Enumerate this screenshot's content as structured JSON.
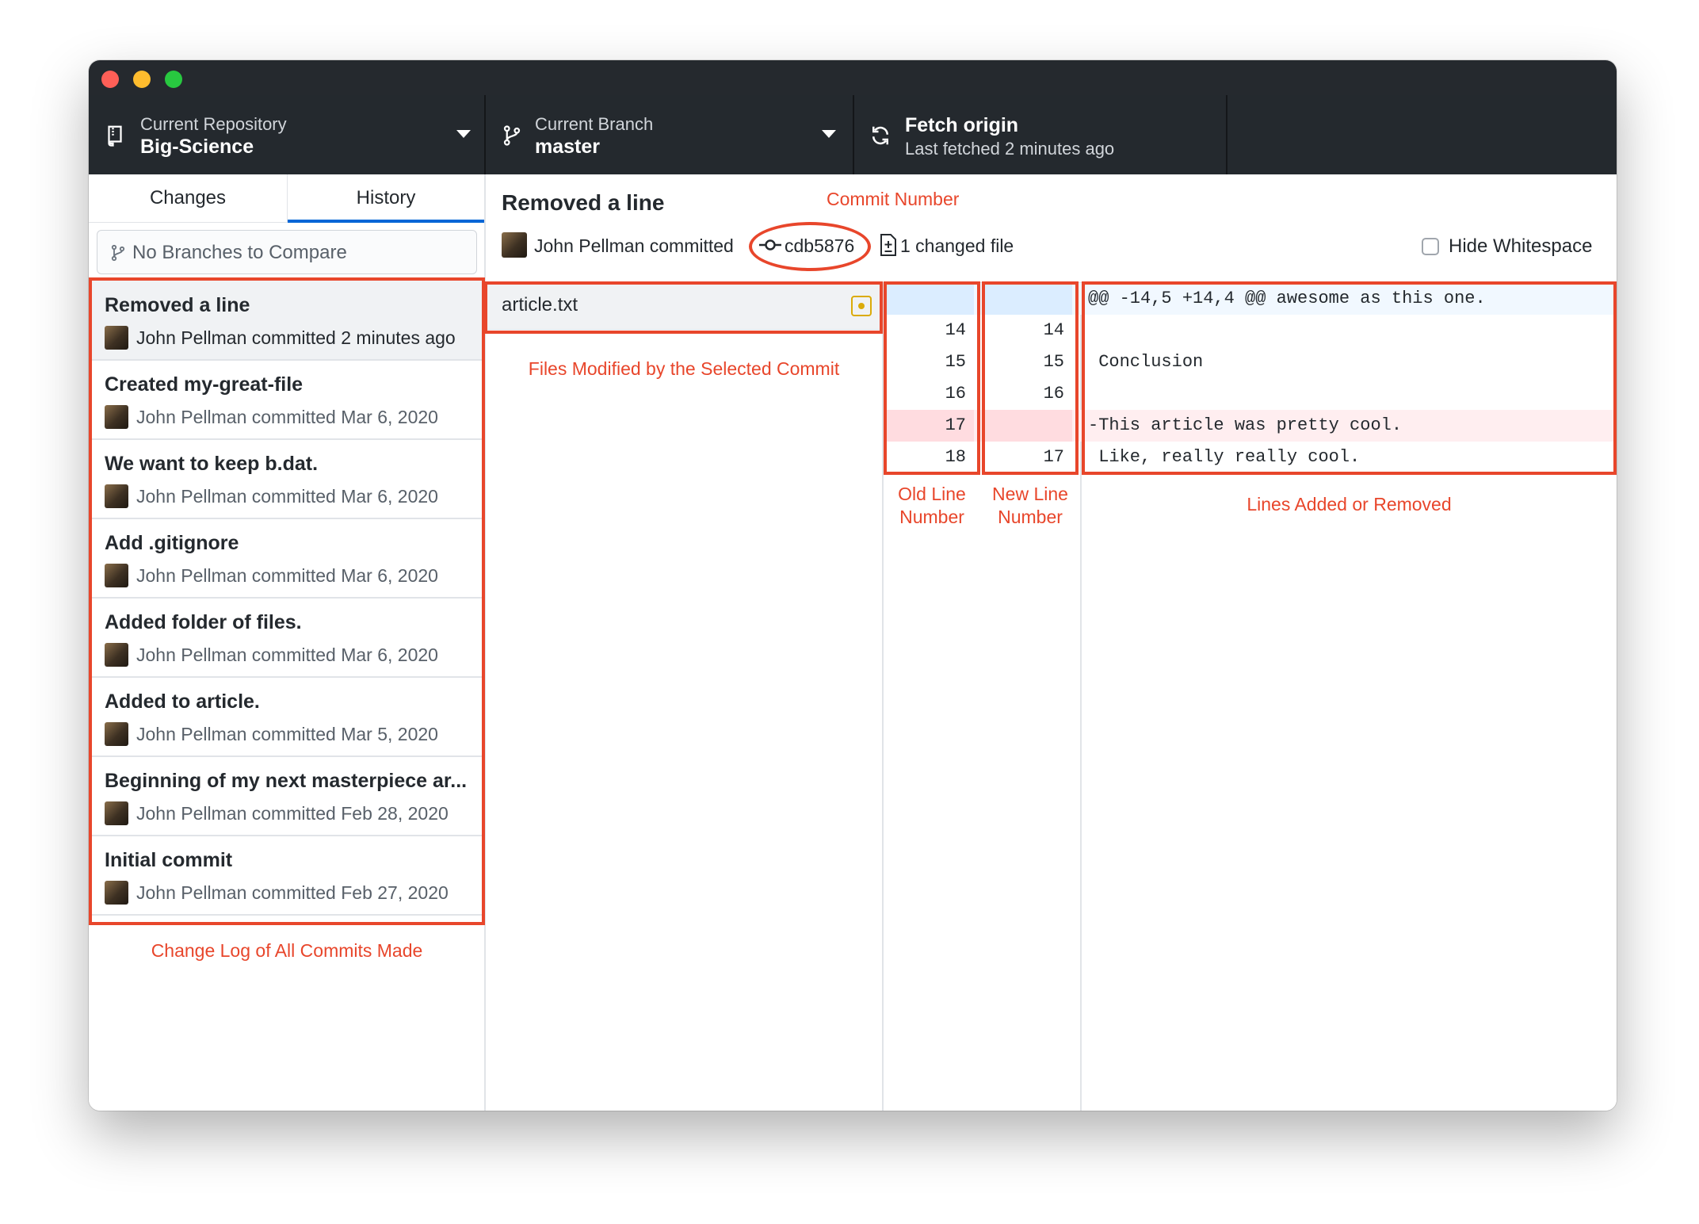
{
  "toolbar": {
    "repository": {
      "label": "Current Repository",
      "value": "Big-Science"
    },
    "branch": {
      "label": "Current Branch",
      "value": "master"
    },
    "fetch": {
      "label": "Fetch origin",
      "sub": "Last fetched 2 minutes ago"
    }
  },
  "sidebar": {
    "tabs": [
      "Changes",
      "History"
    ],
    "compare_placeholder": "No Branches to Compare",
    "commits": [
      {
        "title": "Removed a line",
        "meta": "John Pellman committed 2 minutes ago"
      },
      {
        "title": "Created my-great-file",
        "meta": "John Pellman committed Mar 6, 2020"
      },
      {
        "title": "We want to keep b.dat.",
        "meta": "John Pellman committed Mar 6, 2020"
      },
      {
        "title": "Add .gitignore",
        "meta": "John Pellman committed Mar 6, 2020"
      },
      {
        "title": "Added folder of files.",
        "meta": "John Pellman committed Mar 6, 2020"
      },
      {
        "title": "Added to article.",
        "meta": "John Pellman committed Mar 5, 2020"
      },
      {
        "title": "Beginning of my next masterpiece ar...",
        "meta": "John Pellman committed Feb 28, 2020"
      },
      {
        "title": "Initial commit",
        "meta": "John Pellman committed Feb 27, 2020"
      }
    ]
  },
  "commit": {
    "title": "Removed a line",
    "author_line": "John Pellman committed",
    "sha": "cdb5876",
    "changed_files": "1 changed file",
    "hide_whitespace_label": "Hide Whitespace"
  },
  "files": [
    {
      "name": "article.txt"
    }
  ],
  "diff": {
    "hunk_header": "@@ -14,5 +14,4 @@ awesome as this one.",
    "rows": [
      {
        "old": "14",
        "new": "14",
        "code": "",
        "type": "context"
      },
      {
        "old": "15",
        "new": "15",
        "code": " Conclusion",
        "type": "context"
      },
      {
        "old": "16",
        "new": "16",
        "code": "",
        "type": "context"
      },
      {
        "old": "17",
        "new": "",
        "code": "-This article was pretty cool.",
        "type": "deleted"
      },
      {
        "old": "18",
        "new": "17",
        "code": " Like, really really cool.",
        "type": "context"
      }
    ]
  },
  "annotations": {
    "commit_number": "Commit Number",
    "files_modified": "Files Modified by the Selected Commit",
    "old_line": [
      "Old Line",
      "Number"
    ],
    "new_line": [
      "New Line",
      "Number"
    ],
    "lines_changed": "Lines Added or Removed",
    "change_log": "Change Log of All Commits Made"
  },
  "colors": {
    "annotation": "#e8462b",
    "toolbar_bg": "#24292e",
    "tab_accent": "#0366d6",
    "deleted_line_bg": "#ffeef0",
    "hunk_bg": "#f1f8ff",
    "modified_status": "#dbab09"
  },
  "icons": [
    "repo-icon",
    "branch-icon",
    "sync-icon",
    "commit-icon",
    "file-diff-icon",
    "file-modified-icon",
    "avatar"
  ]
}
